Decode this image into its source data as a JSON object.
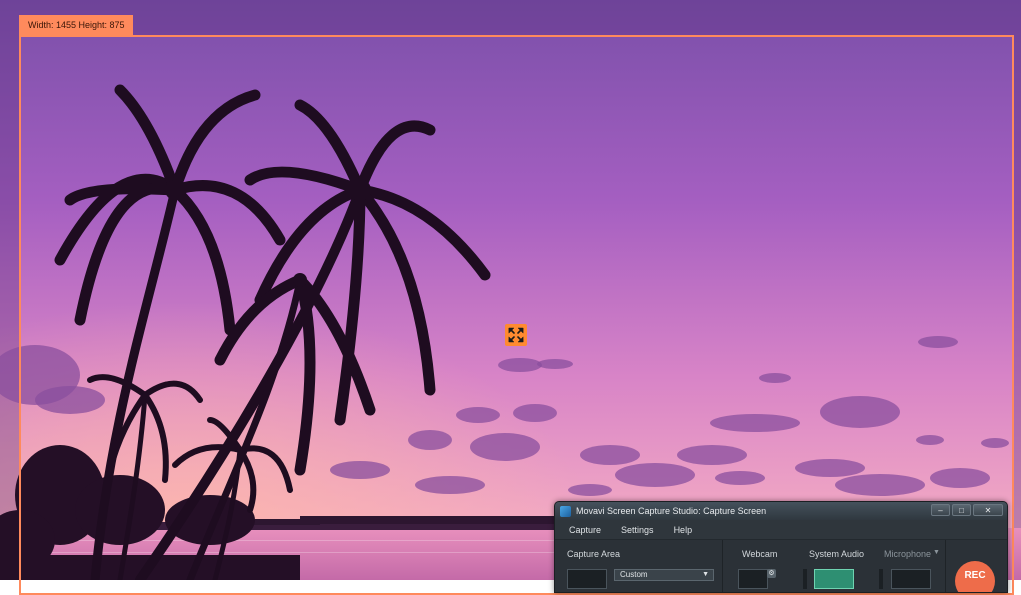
{
  "overlay": {
    "dimension_label": "Width: 1455 Height: 875"
  },
  "capture_window": {
    "title": "Movavi Screen Capture Studio: Capture Screen",
    "window_buttons": [
      "–",
      "□",
      "✕"
    ],
    "menu": [
      "Capture",
      "Settings",
      "Help"
    ],
    "capture_area_label": "Capture Area",
    "capture_area_value": "Custom",
    "webcam_label": "Webcam",
    "system_audio_label": "System Audio",
    "microphone_label": "Microphone",
    "rec_label": "REC"
  },
  "colors": {
    "frame_accent": "#ff8a5c",
    "rec_button": "#ee6c4a",
    "system_audio_active": "#2e8f72"
  }
}
